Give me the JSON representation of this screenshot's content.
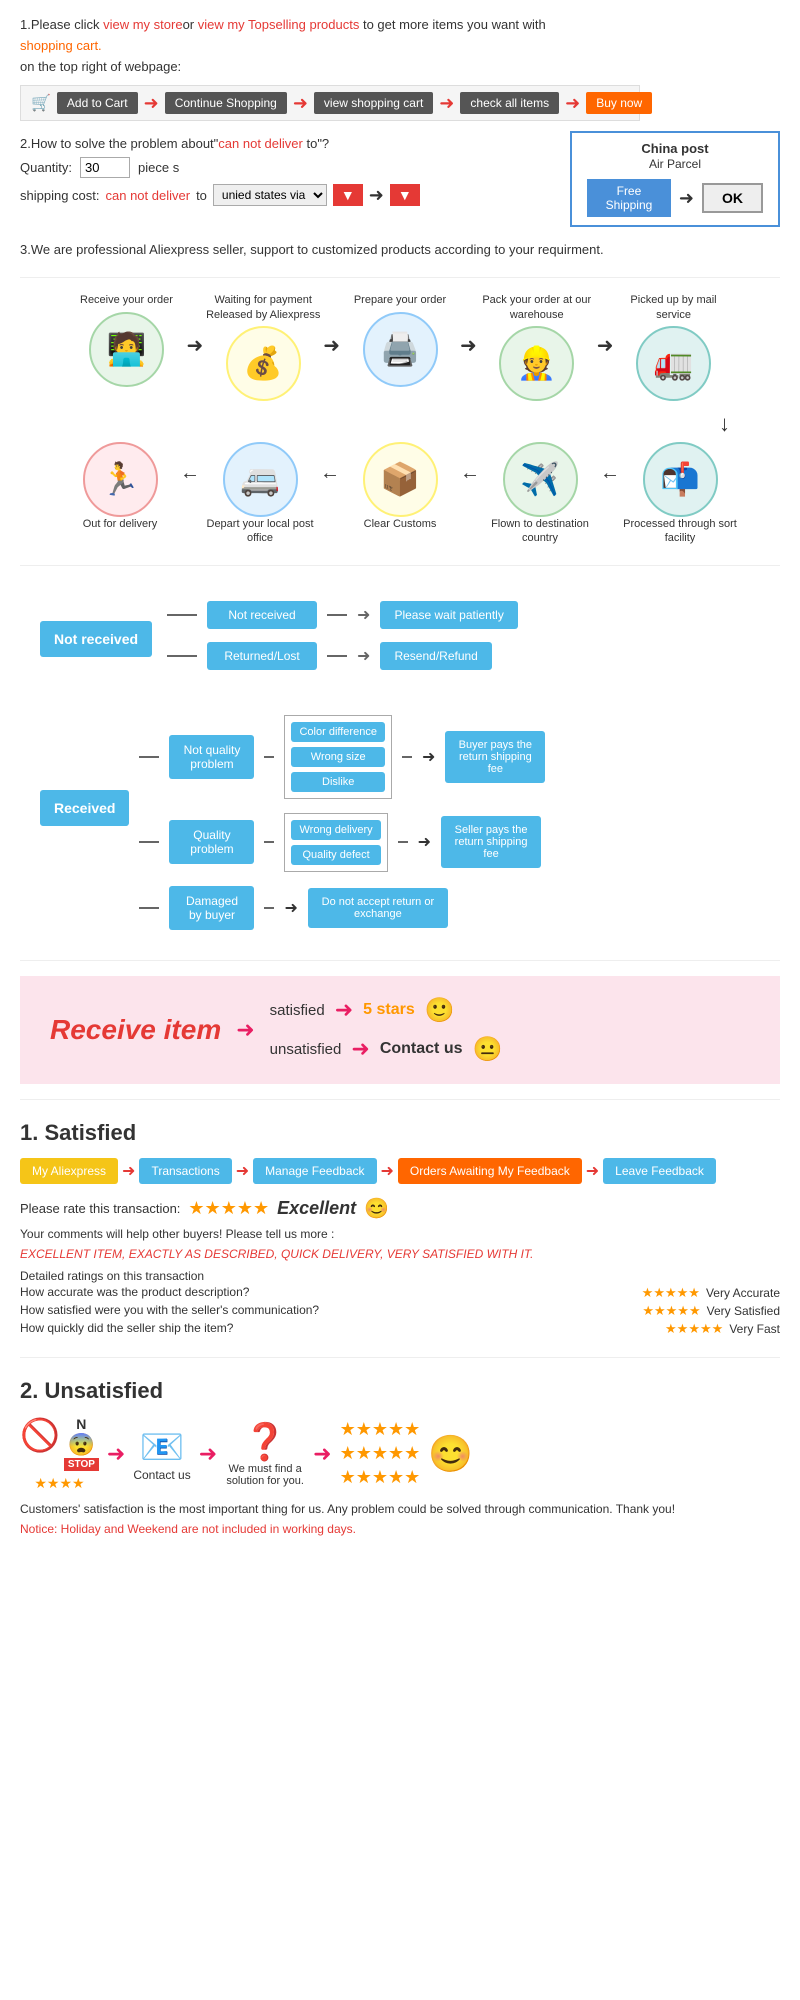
{
  "section1": {
    "text1": "1.Please click ",
    "link1": "view my store",
    "text2": "or ",
    "link2": "view my Topselling products",
    "text3": " to get more items you want with",
    "text4": "shopping cart.",
    "text5": "on the top right of webpage:",
    "cart_steps": [
      "Add to Cart",
      "Continue Shopping",
      "view shopping cart",
      "check all items",
      "Buy now"
    ]
  },
  "section2": {
    "title": "2.How to solve the problem about\"can not deliver to\"?",
    "qty_label": "Quantity:",
    "qty_value": "30",
    "qty_unit": "piece s",
    "ship_label": "shipping cost:",
    "ship_cannot": "can not deliver",
    "ship_to": " to ",
    "ship_via": "unied states via",
    "china_post_title": "China post",
    "china_post_subtitle": "Air Parcel",
    "free_shipping": "Free Shipping",
    "ok_btn": "OK"
  },
  "section3": {
    "text": "3.We are professional Aliexpress seller, support to customized products according to your requirment."
  },
  "process": {
    "steps_top": [
      {
        "label": "Receive your order",
        "icon": "🧑‍💻"
      },
      {
        "label": "Waiting for payment Released by Aliexpress",
        "icon": "💰"
      },
      {
        "label": "Prepare your order",
        "icon": "🖨️"
      },
      {
        "label": "Pack your order at our warehouse",
        "icon": "👷"
      },
      {
        "label": "Picked up by mail service",
        "icon": "🚛"
      }
    ],
    "steps_bottom": [
      {
        "label": "Out for delivery",
        "icon": "🏃"
      },
      {
        "label": "Depart your local post office",
        "icon": "🚐"
      },
      {
        "label": "Clear Customs",
        "icon": "📦"
      },
      {
        "label": "Flown to destination country",
        "icon": "✈️"
      },
      {
        "label": "Processed through sort facility",
        "icon": "📬"
      }
    ]
  },
  "not_received": {
    "main": "Not received",
    "branches": [
      {
        "sub": "Not received",
        "result": "Please wait patiently"
      },
      {
        "sub": "Returned/Lost",
        "result": "Resend/Refund"
      }
    ]
  },
  "received": {
    "main": "Received",
    "branches": [
      {
        "sub": "Not quality problem",
        "items": [
          "Color difference",
          "Wrong size",
          "Dislike"
        ],
        "result": "Buyer pays the return shipping fee"
      },
      {
        "sub": "Quality problem",
        "items": [
          "Wrong delivery",
          "Quality defect"
        ],
        "result": "Seller pays the return shipping fee"
      },
      {
        "sub": "Damaged by buyer",
        "items": [
          "Do not accept return or exchange"
        ],
        "result": ""
      }
    ]
  },
  "satisfaction": {
    "title": "Receive item",
    "row1_text": "satisfied",
    "row1_result": "5 stars",
    "row1_emoji": "🙂",
    "row2_text": "unsatisfied",
    "row2_result": "Contact us",
    "row2_emoji": "😐"
  },
  "satisfied": {
    "section_title": "1. Satisfied",
    "steps": [
      "My Aliexpress",
      "Transactions",
      "Manage Feedback",
      "Orders Awaiting My Feedback",
      "Leave Feedback"
    ],
    "rate_label": "Please rate this transaction:",
    "excellent": "Excellent",
    "excellent_emoji": "😊",
    "comment_prompt": "Your comments will help other buyers! Please tell us more :",
    "excellent_comment": "EXCELLENT ITEM, EXACTLY AS DESCRIBED, QUICK DELIVERY, VERY SATISFIED WITH IT.",
    "detail_title": "Detailed ratings on this transaction",
    "details": [
      {
        "question": "How accurate was the product description?",
        "rating": "Very Accurate"
      },
      {
        "question": "How satisfied were you with the seller's communication?",
        "rating": "Very Satisfied"
      },
      {
        "question": "How quickly did the seller ship the item?",
        "rating": "Very Fast"
      }
    ]
  },
  "unsatisfied": {
    "section_title": "2. Unsatisfied",
    "icons": [
      "🚫",
      "😨",
      "📧",
      "❓",
      "😊"
    ],
    "contact_us": "Contact us",
    "find_solution": "We must find a solution for you.",
    "footer_text": "Customers' satisfaction is the most important thing for us. Any problem could be solved through communication. Thank you!",
    "notice": "Notice: Holiday and Weekend are not included in working days."
  }
}
